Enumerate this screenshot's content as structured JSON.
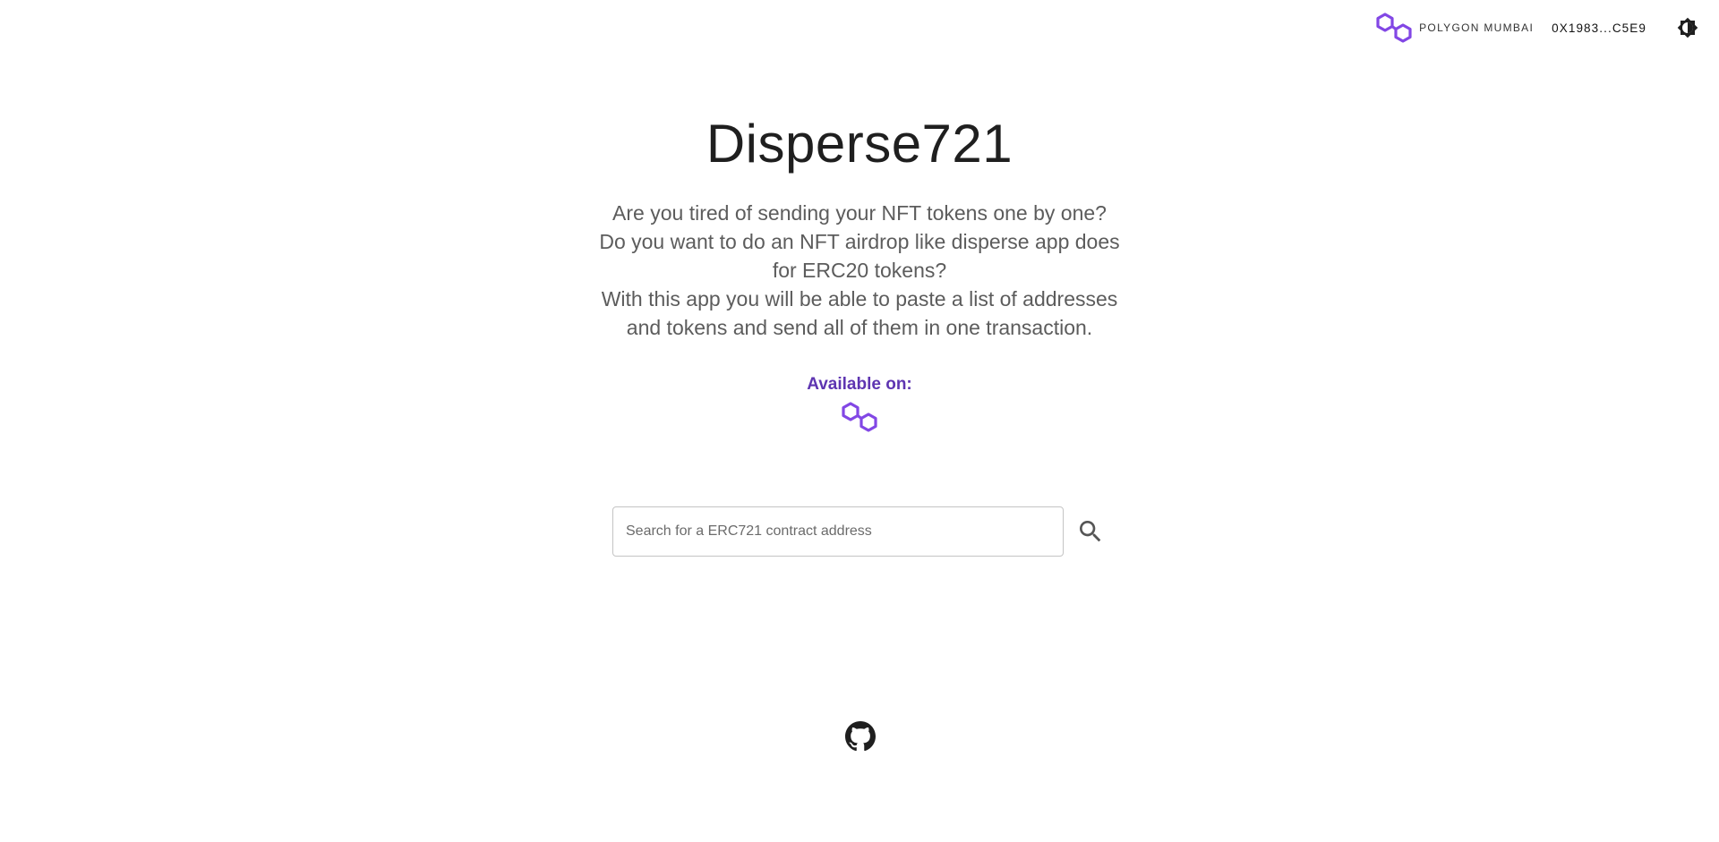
{
  "header": {
    "network_label": "POLYGON MUMBAI",
    "network_icon": "polygon-logo-icon",
    "account_label": "0X1983...C5E9",
    "theme_icon": "brightness-icon"
  },
  "hero": {
    "title": "Disperse721",
    "description_lines": [
      "Are you tired of sending your NFT tokens one by one?",
      "Do you want to do an NFT airdrop like disperse app does for ERC20 tokens?",
      "With this app you will be able to paste a list of addresses and tokens and send all of them in one transaction."
    ],
    "available_label": "Available on:",
    "available_icon": "polygon-logo-icon"
  },
  "search": {
    "value": "",
    "placeholder": "Search for a ERC721 contract address",
    "button_icon": "search-icon"
  },
  "footer": {
    "github_icon": "github-icon"
  },
  "colors": {
    "polygon_purple": "#8247e5",
    "accent": "#5e35b1",
    "text_muted": "#5c5c5c"
  }
}
